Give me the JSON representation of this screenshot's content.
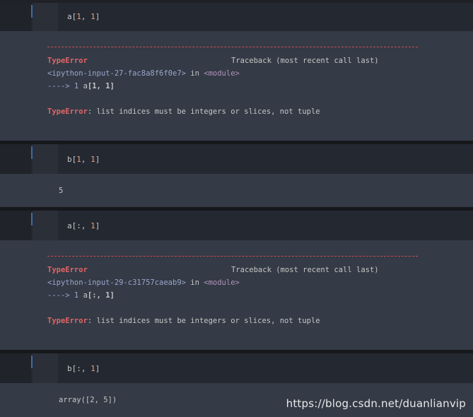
{
  "cells": [
    {
      "input": {
        "prefix": "a[",
        "n1": "1",
        "sep": ", ",
        "n2": "1",
        "suffix": "]"
      },
      "error": {
        "type": "TypeError",
        "traceback_label": "Traceback (most recent call last)",
        "file": "<ipython-input-27-fac8a8f6f0e7>",
        "in_text": " in ",
        "module": "<module>",
        "arrow": "----> 1 ",
        "code_prefix": "a",
        "code_hl": "[1, 1]",
        "message": ": list indices must be integers or slices, not tuple"
      }
    },
    {
      "input": {
        "prefix": "b[",
        "n1": "1",
        "sep": ", ",
        "n2": "1",
        "suffix": "]"
      },
      "output": "5"
    },
    {
      "input": {
        "prefix": "a[:, ",
        "n2": "1",
        "suffix": "]"
      },
      "error": {
        "type": "TypeError",
        "traceback_label": "Traceback (most recent call last)",
        "file": "<ipython-input-29-c31757caeab9>",
        "in_text": " in ",
        "module": "<module>",
        "arrow": "----> 1 ",
        "code_prefix": "a",
        "code_hl": "[:, 1]",
        "message": ": list indices must be integers or slices, not tuple"
      }
    },
    {
      "input": {
        "prefix": "b[:, ",
        "n2": "1",
        "suffix": "]"
      },
      "output": "array([2, 5])"
    }
  ],
  "watermark": "https://blog.csdn.net/duanlianvip"
}
